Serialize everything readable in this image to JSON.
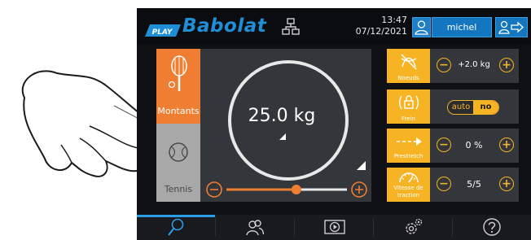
{
  "header": {
    "brand_badge": "PLAY",
    "brand_name": "Babolat",
    "time": "13:47",
    "date": "07/12/2021",
    "username": "michel"
  },
  "left_panel": {
    "tabs": [
      {
        "label": "Montants",
        "active": true,
        "icon": "racket-icon"
      },
      {
        "label": "Tennis",
        "active": false,
        "icon": "tennis-ball-icon"
      }
    ],
    "tension": "25.0 kg",
    "slider_fraction": 0.58
  },
  "right_panels": [
    {
      "icon": "knots-icon",
      "label": "Noeuds",
      "value": "+2.0 kg"
    },
    {
      "icon": "lock-icon",
      "label": "Frein",
      "toggle_options": [
        "auto",
        "no"
      ],
      "toggle_selected": "no"
    },
    {
      "icon": "prestretch-arrow-icon",
      "label": "Prestretch",
      "value": "0 %"
    },
    {
      "icon": "speedometer-icon",
      "label_line1": "Vitesse de",
      "label_line2": "traction",
      "value": "5/5"
    }
  ],
  "bottom_nav": [
    {
      "icon": "racket-icon",
      "active": true
    },
    {
      "icon": "users-icon",
      "active": false
    },
    {
      "icon": "video-icon",
      "active": false
    },
    {
      "icon": "settings-icon",
      "active": false
    },
    {
      "icon": "help-icon",
      "active": false
    }
  ],
  "colors": {
    "accent_orange": "#ef7d32",
    "accent_yellow": "#f6b324",
    "brand_blue": "#1e8fd6",
    "background": "#0f1013"
  }
}
